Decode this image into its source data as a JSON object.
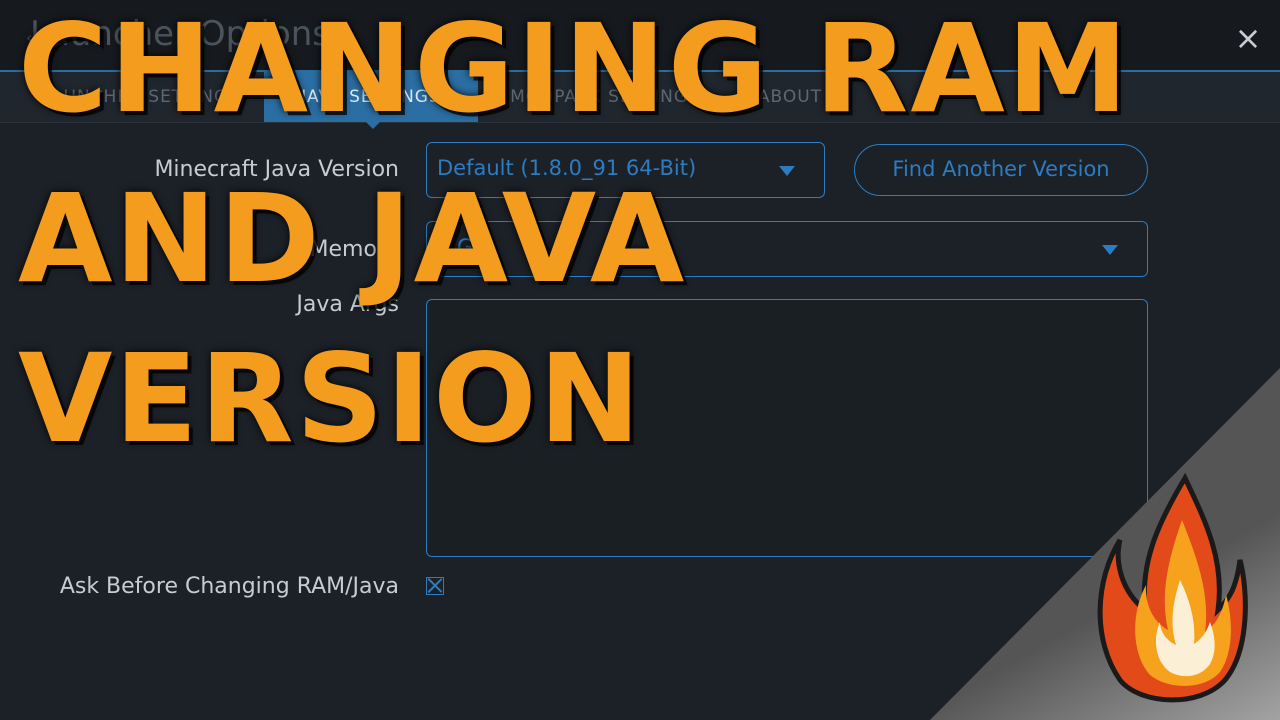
{
  "window": {
    "title": "Launcher Options",
    "close_glyph": "×"
  },
  "tabs": [
    {
      "label": "LAUNCHER SETTINGS",
      "active": false
    },
    {
      "label": "JAVA SETTINGS",
      "active": true
    },
    {
      "label": "MODPACK SETTINGS",
      "active": false
    },
    {
      "label": "ABOUT",
      "active": false
    }
  ],
  "java_settings": {
    "java_version": {
      "label": "Minecraft Java Version",
      "value": "Default (1.8.0_91 64-Bit)",
      "find_button": "Find Another Version"
    },
    "memory": {
      "label": "Memory",
      "value": "G"
    },
    "java_args": {
      "label": "Java Args",
      "value": ""
    },
    "ask_before": {
      "label": "Ask Before Changing RAM/Java",
      "checked": true
    }
  },
  "overlay": {
    "lines": [
      "CHANGING RAM",
      "AND JAVA",
      "VERSION"
    ],
    "color": "#f39c1e"
  },
  "colors": {
    "accent": "#2d7cc1",
    "background": "#1c2127",
    "tab_active": "#2b6ea3"
  },
  "icons": {
    "back": "chevron-left-icon",
    "close": "close-icon",
    "caret": "caret-down-icon",
    "logo": "flame-icon"
  }
}
